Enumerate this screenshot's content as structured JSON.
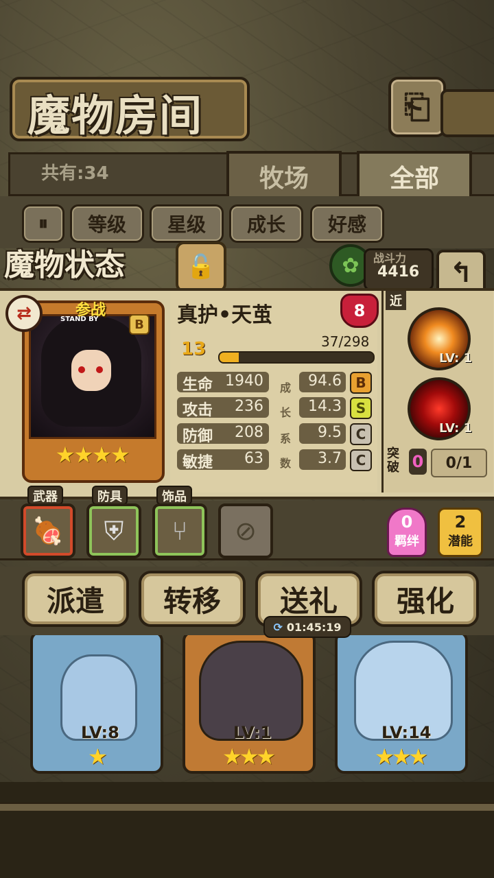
{
  "header": {
    "title": "魔物房间",
    "back_icon": "back-arrow-icon"
  },
  "tabs": {
    "count_label": "共有:34",
    "items": [
      {
        "label": "牧场",
        "active": false
      },
      {
        "label": "全部",
        "active": true
      }
    ]
  },
  "filters": {
    "pause_icon": "pause-icon",
    "items": [
      "等级",
      "星级",
      "成长",
      "好感"
    ]
  },
  "status": {
    "title": "魔物状态",
    "lock_icon": "lock-icon",
    "element_icon": "leaf-icon",
    "power_label": "战斗力",
    "power_value": "4416",
    "return_icon": "return-arrow-icon"
  },
  "monster": {
    "standby_badge": "参战",
    "standby_sub": "STAND BY",
    "rank": "B",
    "stars": "★★★★",
    "name": "真护•天茧",
    "affection": "8",
    "level": "13",
    "exp_text": "37/298",
    "exp_fraction": 0.124,
    "stats": [
      {
        "label": "生命",
        "value": "1940"
      },
      {
        "label": "攻击",
        "value": "236"
      },
      {
        "label": "防御",
        "value": "208"
      },
      {
        "label": "敏捷",
        "value": "63"
      }
    ],
    "growth_marks": [
      "成",
      "长",
      "系",
      "数"
    ],
    "growth": [
      {
        "value": "94.6",
        "grade": "B"
      },
      {
        "value": "14.3",
        "grade": "S"
      },
      {
        "value": "9.5",
        "grade": "C"
      },
      {
        "value": "3.7",
        "grade": "C"
      }
    ]
  },
  "skills": {
    "range": "近",
    "items": [
      {
        "lv": "LV: 1",
        "icon": "cross-slash-skill-icon"
      },
      {
        "lv": "LV: 1",
        "icon": "red-vortex-skill-icon"
      }
    ],
    "break_label": "突破",
    "break_count": "0",
    "break_progress": "0/1"
  },
  "equipment": {
    "labels": [
      "武器",
      "防具",
      "饰品"
    ],
    "slots": [
      {
        "icon": "meat-weapon-icon"
      },
      {
        "icon": "shield-armor-icon"
      },
      {
        "icon": "fork-accessory-icon"
      },
      {
        "icon": "empty-slot-icon"
      }
    ],
    "bond_count": "0",
    "bond_label": "羁绊",
    "potential_count": "2",
    "potential_label": "潜能"
  },
  "actions": {
    "items": [
      "派遣",
      "转移",
      "送礼",
      "强化"
    ],
    "timer": "01:45:19",
    "timer_icon": "refresh-icon"
  },
  "cards": [
    {
      "lv": "LV:8",
      "stars": "★"
    },
    {
      "lv": "LV:1",
      "stars": "★★★"
    },
    {
      "lv": "LV:14",
      "stars": "★★★"
    }
  ]
}
